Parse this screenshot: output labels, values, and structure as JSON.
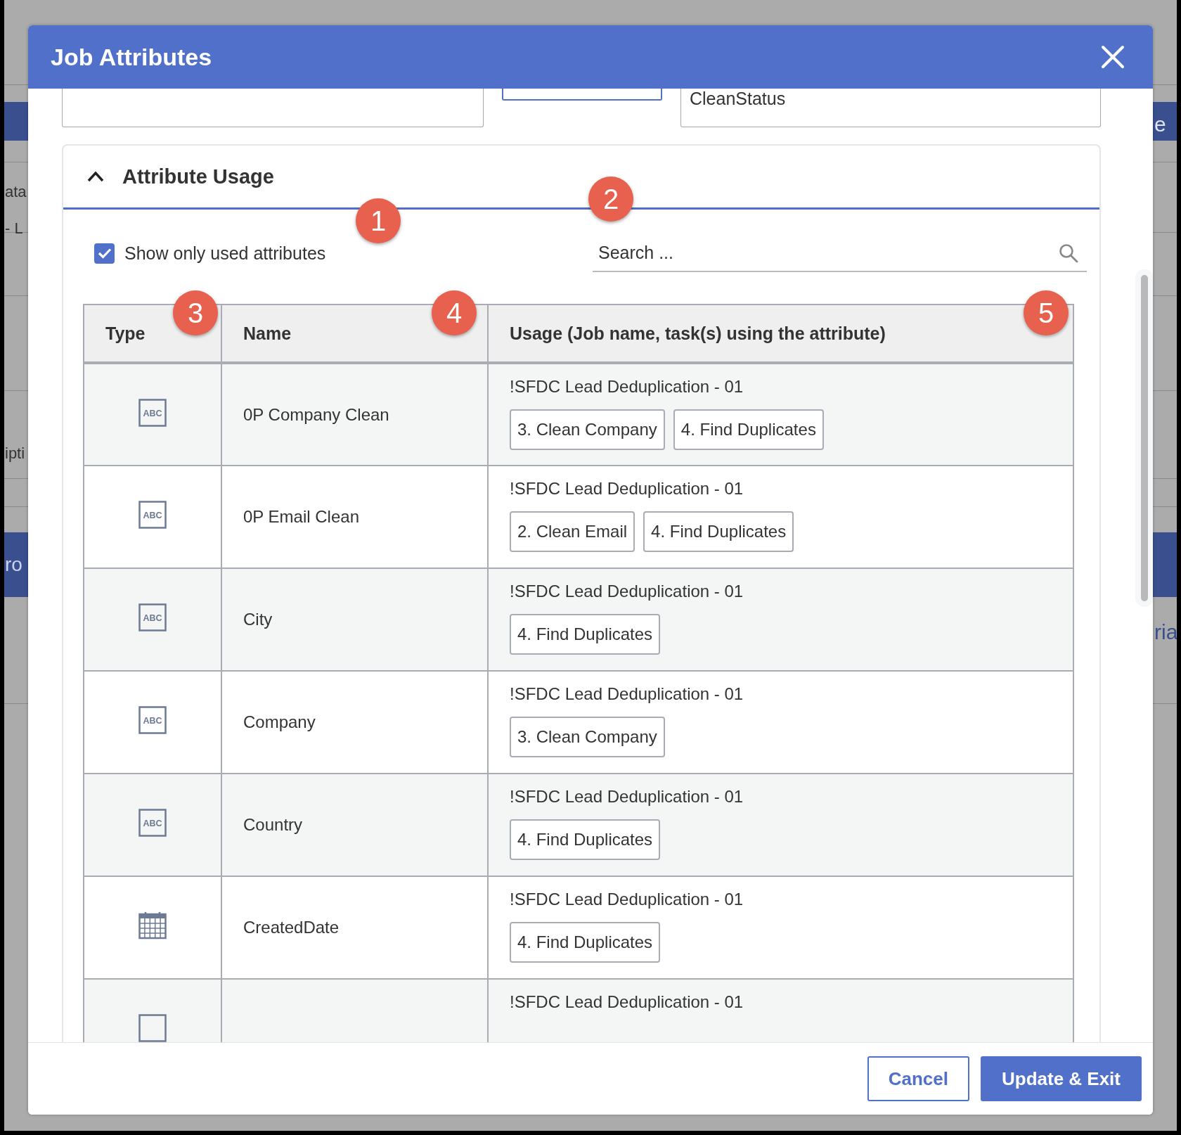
{
  "background": {
    "left_fragments": [
      "ata",
      "- L",
      "ipti",
      "ro"
    ],
    "right_fragments": [
      "e",
      "ria"
    ]
  },
  "dialog": {
    "title": "Job Attributes",
    "top_fields": {
      "list_item": "CleanStatus"
    },
    "section": {
      "title": "Attribute Usage",
      "expanded": true,
      "filter": {
        "label": "Show only used attributes",
        "checked": true
      },
      "search": {
        "placeholder": "Search ..."
      },
      "columns": [
        "Type",
        "Name",
        "Usage (Job name, task(s) using the attribute)"
      ],
      "rows": [
        {
          "kind": "text",
          "type_label": "ABC",
          "name": "0P Company Clean",
          "job": "!SFDC Lead Deduplication - 01",
          "tasks": [
            "3. Clean Company",
            "4. Find Duplicates"
          ]
        },
        {
          "kind": "text",
          "type_label": "ABC",
          "name": "0P Email Clean",
          "job": "!SFDC Lead Deduplication - 01",
          "tasks": [
            "2. Clean Email",
            "4. Find Duplicates"
          ]
        },
        {
          "kind": "text",
          "type_label": "ABC",
          "name": "City",
          "job": "!SFDC Lead Deduplication - 01",
          "tasks": [
            "4. Find Duplicates"
          ]
        },
        {
          "kind": "text",
          "type_label": "ABC",
          "name": "Company",
          "job": "!SFDC Lead Deduplication - 01",
          "tasks": [
            "3. Clean Company"
          ]
        },
        {
          "kind": "text",
          "type_label": "ABC",
          "name": "Country",
          "job": "!SFDC Lead Deduplication - 01",
          "tasks": [
            "4. Find Duplicates"
          ]
        },
        {
          "kind": "date",
          "name": "CreatedDate",
          "job": "!SFDC Lead Deduplication - 01",
          "tasks": [
            "4. Find Duplicates"
          ]
        },
        {
          "kind": "text",
          "job": "!SFDC Lead Deduplication - 01"
        }
      ]
    },
    "buttons": [
      {
        "label": "Cancel",
        "kind": "secondary"
      },
      {
        "label": "Update & Exit",
        "kind": "primary"
      }
    ]
  },
  "annotations": [
    "1",
    "2",
    "3",
    "4",
    "5"
  ]
}
